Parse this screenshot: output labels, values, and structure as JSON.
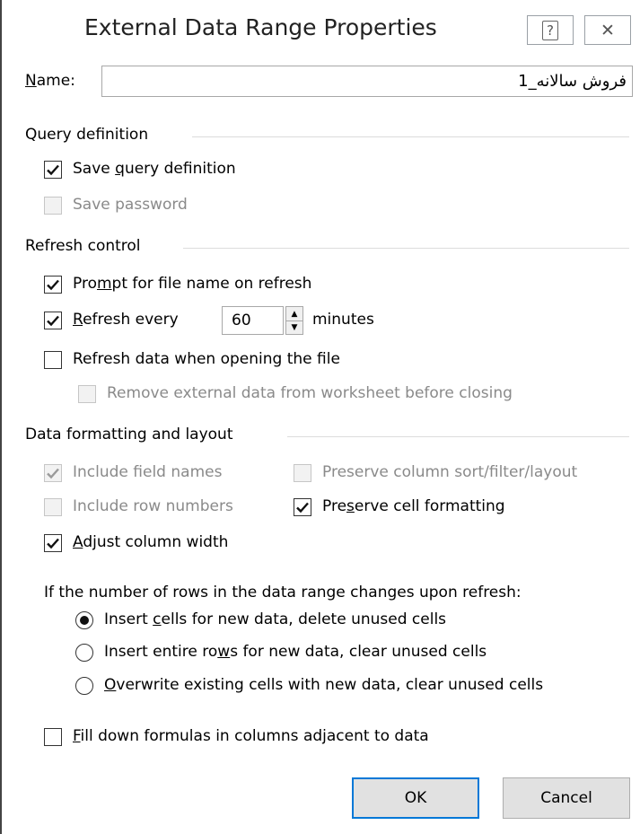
{
  "dialog": {
    "title": "External Data Range Properties",
    "help_glyph": "?",
    "close_glyph": "✕"
  },
  "name": {
    "label": "Name:",
    "value": "فروش سالانه_1"
  },
  "query_definition": {
    "group_title": "Query definition",
    "save_query": {
      "label": "Save query definition",
      "checked": true,
      "enabled": true
    },
    "save_password": {
      "label": "Save password",
      "checked": false,
      "enabled": false
    }
  },
  "refresh_control": {
    "group_title": "Refresh control",
    "prompt_file_name": {
      "label": "Prompt for file name on refresh",
      "checked": true
    },
    "refresh_every": {
      "label": "Refresh every",
      "value": "60",
      "unit": "minutes",
      "checked": true
    },
    "refresh_on_open": {
      "label": "Refresh data when opening the file",
      "checked": false
    },
    "remove_external": {
      "label": "Remove external data from worksheet before closing",
      "checked": false,
      "enabled": false
    }
  },
  "data_formatting": {
    "group_title": "Data formatting and layout",
    "include_field_names": {
      "label": "Include field names",
      "checked": true,
      "enabled": false
    },
    "preserve_sort": {
      "label": "Preserve column sort/filter/layout",
      "checked": false,
      "enabled": false
    },
    "include_row_numbers": {
      "label": "Include row numbers",
      "checked": false,
      "enabled": false
    },
    "preserve_cell_formatting": {
      "label": "Preserve cell formatting",
      "checked": true
    },
    "adjust_column_width": {
      "label": "Adjust column width",
      "checked": true
    },
    "rows_change_prompt": "If the number of rows in the data range changes upon refresh:",
    "radio_options": [
      {
        "label": "Insert cells for new data, delete unused cells",
        "selected": true
      },
      {
        "label": "Insert entire rows for new data, clear unused cells",
        "selected": false
      },
      {
        "label": "Overwrite existing cells with new data, clear unused cells",
        "selected": false
      }
    ],
    "fill_down": {
      "label": "Fill down formulas in columns adjacent to data",
      "checked": false
    }
  },
  "buttons": {
    "ok": "OK",
    "cancel": "Cancel"
  },
  "colors": {
    "accent": "#0078d7",
    "disabled_text": "#8a8a8a",
    "group_line": "#dcdcdc"
  }
}
